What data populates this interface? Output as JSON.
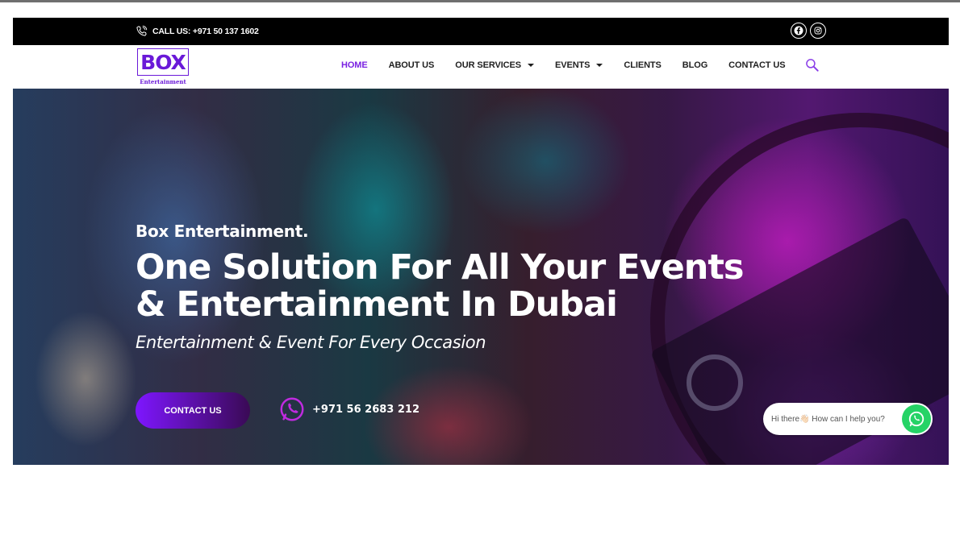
{
  "topbar": {
    "call_text": "CALL US: +971 50 137 1602",
    "social": [
      {
        "icon": "facebook-icon"
      },
      {
        "icon": "instagram-icon"
      }
    ]
  },
  "logo": {
    "word": "BOX",
    "sub": "Entertainment"
  },
  "nav": {
    "items": [
      {
        "label": "HOME",
        "active": true
      },
      {
        "label": "ABOUT US"
      },
      {
        "label": "OUR SERVICES",
        "dropdown": true
      },
      {
        "label": "EVENTS",
        "dropdown": true
      },
      {
        "label": "CLIENTS"
      },
      {
        "label": "BLOG"
      },
      {
        "label": "CONTACT US"
      }
    ],
    "search_icon": "search-icon"
  },
  "hero": {
    "kicker": "Box Entertainment.",
    "headline_line1": "One Solution For All Your Events",
    "headline_line2": "& Entertainment In Dubai",
    "tagline": "Entertainment & Event For Every Occasion",
    "cta_label": "CONTACT US",
    "phone": "+971 56 2683 212"
  },
  "whatsapp": {
    "text": "Hi there👋🏻 How can I help you?"
  },
  "colors": {
    "accent": "#7a22e2",
    "logo": "#6a19d8",
    "whatsapp": "#25d366"
  }
}
